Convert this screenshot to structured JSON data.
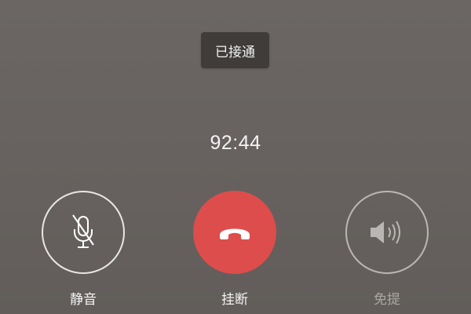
{
  "call": {
    "status": "已接通",
    "duration": "92:44"
  },
  "controls": {
    "mute": {
      "label": "静音",
      "icon": "mic-off-icon"
    },
    "hangup": {
      "label": "挂断",
      "icon": "phone-hangup-icon",
      "color": "#dc4d4c"
    },
    "speaker": {
      "label": "免提",
      "icon": "speaker-icon"
    }
  },
  "colors": {
    "background": "#67625f",
    "toast": "#3f3c3a",
    "hangup": "#dc4d4c"
  }
}
